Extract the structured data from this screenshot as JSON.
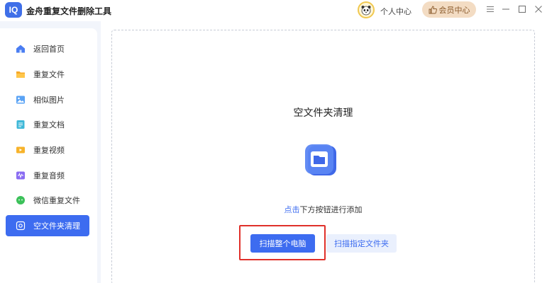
{
  "app": {
    "logo_text": "IQ",
    "title": "金舟重复文件删除工具"
  },
  "header": {
    "user_center_label": "个人中心",
    "vip_label": "会员中心",
    "vip_color": "#f3dcc3",
    "accent_color": "#3d6cf0",
    "window_controls": [
      "menu-icon",
      "minimize-icon",
      "maximize-icon",
      "close-icon"
    ]
  },
  "sidebar": {
    "items": [
      {
        "label": "返回首页",
        "icon": "home-icon",
        "active": false
      },
      {
        "label": "重复文件",
        "icon": "folder-icon",
        "active": false
      },
      {
        "label": "相似图片",
        "icon": "image-icon",
        "active": false
      },
      {
        "label": "重复文档",
        "icon": "document-icon",
        "active": false
      },
      {
        "label": "重复视频",
        "icon": "video-icon",
        "active": false
      },
      {
        "label": "重复音频",
        "icon": "audio-icon",
        "active": false
      },
      {
        "label": "微信重复文件",
        "icon": "wechat-icon",
        "active": false
      },
      {
        "label": "空文件夹清理",
        "icon": "empty-folder-icon",
        "active": true
      }
    ]
  },
  "main": {
    "title": "空文件夹清理",
    "hint_link": "点击",
    "hint_text": "下方按钮进行添加",
    "scan_pc_label": "扫描整个电脑",
    "scan_folder_label": "扫描指定文件夹"
  }
}
